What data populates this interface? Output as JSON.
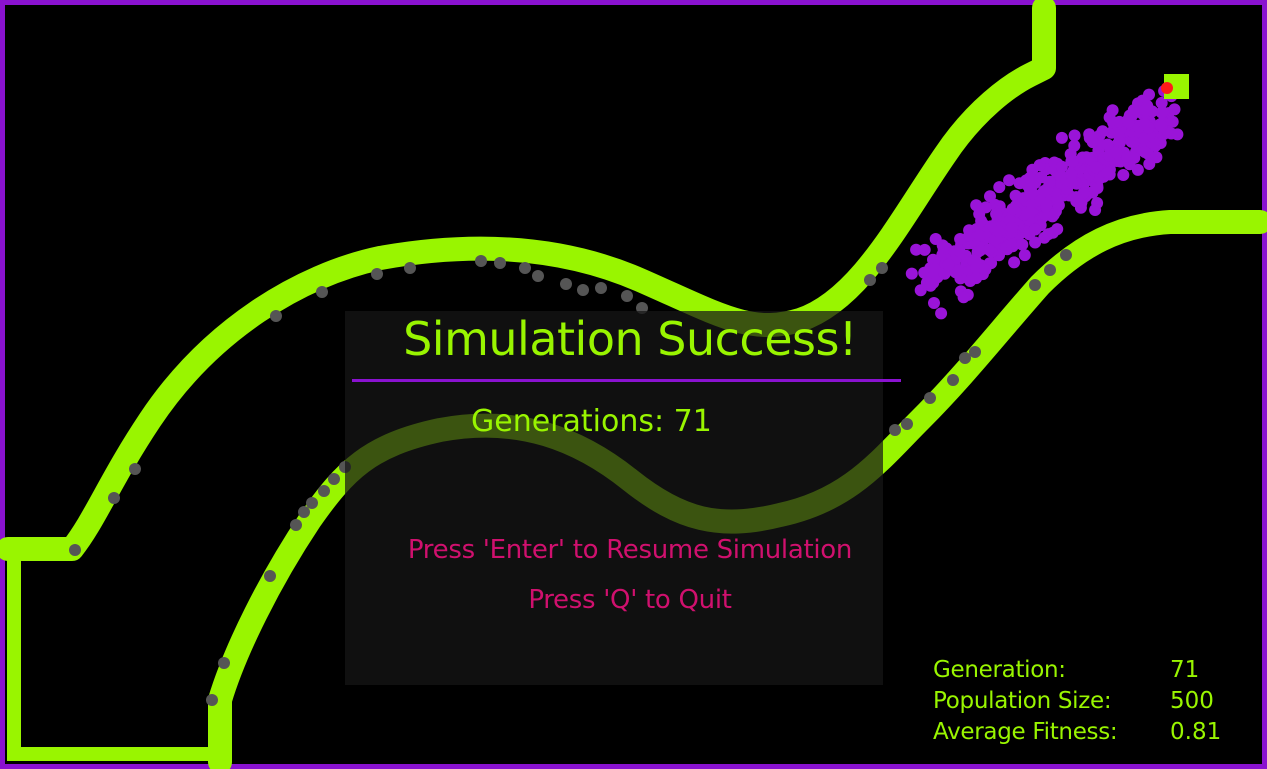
{
  "colors": {
    "background": "#000000",
    "border": "#8a12d0",
    "wall": "#99f500",
    "population": "#9a14d8",
    "dead_agent": "#555555",
    "goal": "#99f500",
    "best_agent": "#ff1a1a",
    "overlay_title": "#99f500",
    "overlay_divider": "#8a12d0",
    "overlay_hint": "#d0106e",
    "stats_text": "#99f500"
  },
  "overlay": {
    "title": "Simulation Success!",
    "generations_label": "Generations: 71",
    "hint_resume": "Press 'Enter' to Resume Simulation",
    "hint_quit": "Press 'Q' to Quit"
  },
  "stats": [
    {
      "label": "Generation:",
      "value": "71"
    },
    {
      "label": "Population Size:",
      "value": "500"
    },
    {
      "label": "Average Fitness:",
      "value": "0.81"
    }
  ],
  "icons": {
    "goal": "goal-square-icon",
    "best_agent": "best-agent-dot-icon"
  }
}
